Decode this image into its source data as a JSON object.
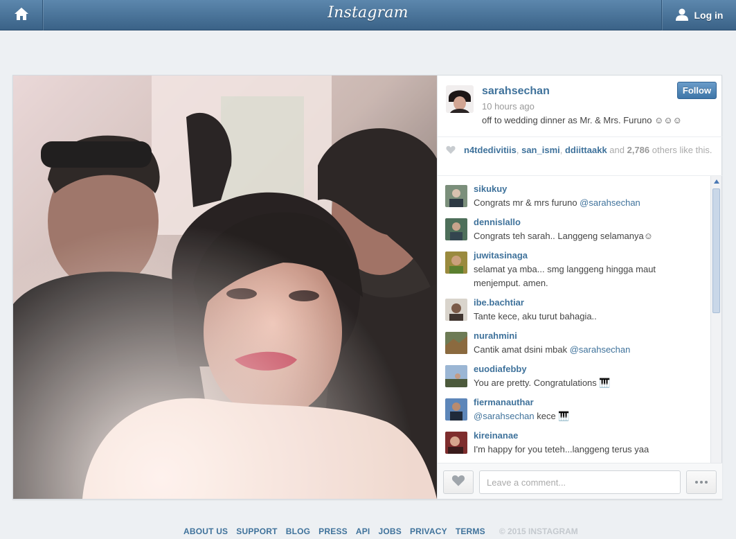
{
  "topbar": {
    "logo": "Instagram",
    "login_label": "Log in",
    "icons": [
      "home-icon",
      "user-icon"
    ]
  },
  "post": {
    "username": "sarahsechan",
    "time_ago": "10 hours ago",
    "caption": "off to wedding dinner as Mr. & Mrs. Furuno ☺☺☺",
    "follow_label": "Follow",
    "likes": {
      "user1": "n4tdedivitiis",
      "sep1": ", ",
      "user2": "san_ismi",
      "sep2": ", ",
      "user3": "ddiittaakk",
      "and": " and ",
      "count": "2,786",
      "rest": " others like this."
    },
    "comments": [
      {
        "user": "sikukuy",
        "text": "Congrats mr & mrs furuno ",
        "mention": "@sarahsechan",
        "after": ""
      },
      {
        "user": "dennislallo",
        "text": "Congrats teh sarah.. Langgeng selamanya☺",
        "mention": "",
        "after": ""
      },
      {
        "user": "juwitasinaga",
        "text": "selamat ya mba... smg langgeng hingga maut menjemput. amen.",
        "mention": "",
        "after": ""
      },
      {
        "user": "ibe.bachtiar",
        "text": "Tante kece, aku turut bahagia..",
        "mention": "",
        "after": ""
      },
      {
        "user": "nurahmini",
        "text": "Cantik amat dsini mbak ",
        "mention": "@sarahsechan",
        "after": ""
      },
      {
        "user": "euodiafebby",
        "text": "You are pretty. Congratulations 🎹",
        "mention": "",
        "after": ""
      },
      {
        "user": "fiermanauthar",
        "text": "",
        "mention": "@sarahsechan",
        "after": " kece 🎹"
      },
      {
        "user": "kireinanae",
        "text": "I'm happy for you teteh...langgeng terus yaa",
        "mention": "",
        "after": ""
      }
    ],
    "comment_placeholder": "Leave a comment..."
  },
  "footer": {
    "links": [
      "ABOUT US",
      "SUPPORT",
      "BLOG",
      "PRESS",
      "API",
      "JOBS",
      "PRIVACY",
      "TERMS"
    ],
    "copyright": "© 2015 INSTAGRAM"
  },
  "colors": {
    "topbar": "#3f6a91",
    "link": "#3f729b",
    "background": "#edf0f3"
  }
}
